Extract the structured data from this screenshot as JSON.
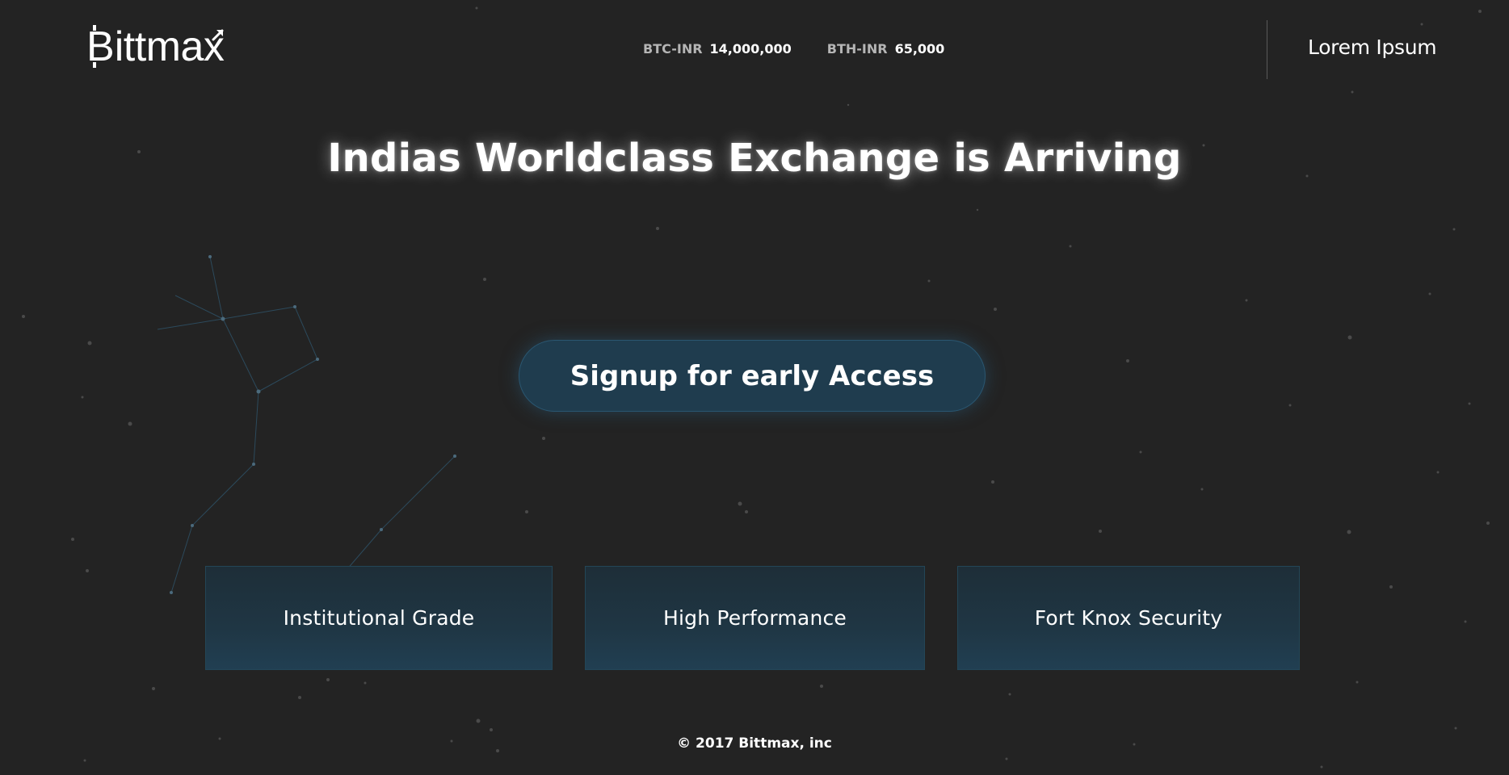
{
  "colors": {
    "background": "#232323",
    "accent": "#1f3c4e",
    "card": "#1f3644"
  },
  "header": {
    "logo_text": "ittmax",
    "logo_icon": "bitcoin-b-icon",
    "ticker": [
      {
        "pair": "BTC-INR",
        "value": "14,000,000"
      },
      {
        "pair": "BTH-INR",
        "value": "65,000"
      }
    ],
    "link_label": "Lorem Ipsum"
  },
  "hero": {
    "title": "Indias Worldclass Exchange is Arriving",
    "cta_label": "Signup for early Access"
  },
  "features": [
    {
      "label": "Institutional Grade"
    },
    {
      "label": "High Performance"
    },
    {
      "label": "Fort Knox Security"
    }
  ],
  "footer": {
    "copyright": "© 2017 Bittmax, inc"
  }
}
